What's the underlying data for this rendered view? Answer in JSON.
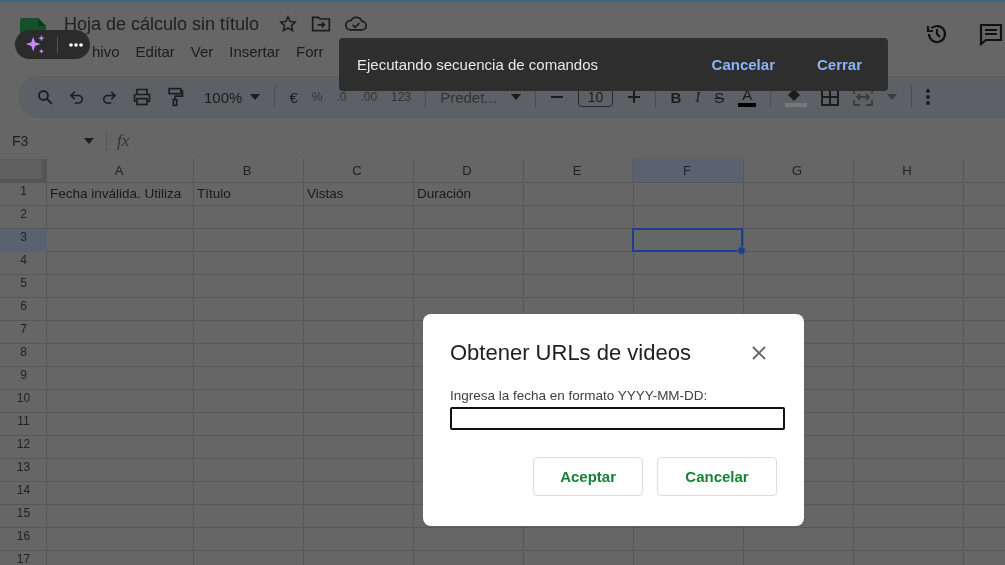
{
  "document": {
    "title": "Hoja de cálculo sin título"
  },
  "menus": [
    "hivo",
    "Editar",
    "Ver",
    "Insertar",
    "Forr"
  ],
  "toolbar": {
    "zoom": "100%",
    "currency": "€",
    "percent": "%",
    "decrease_decimals": ".0",
    "increase_decimals": ".00",
    "number_format": "123",
    "font": "Predet...",
    "font_size": "10",
    "bold": "B",
    "italic": "I",
    "strikethrough": "S",
    "text_color": "A"
  },
  "name_box": "F3",
  "formula_label": "fx",
  "columns": [
    {
      "label": "A",
      "selected": false
    },
    {
      "label": "B",
      "selected": false
    },
    {
      "label": "C",
      "selected": false
    },
    {
      "label": "D",
      "selected": false
    },
    {
      "label": "E",
      "selected": false
    },
    {
      "label": "F",
      "selected": true
    },
    {
      "label": "G",
      "selected": false
    },
    {
      "label": "H",
      "selected": false
    }
  ],
  "rows": [
    {
      "label": "1",
      "selected": false,
      "cells": [
        "Fecha inválida. Utiliza",
        "Título",
        "Vistas",
        "Duración"
      ]
    },
    {
      "label": "2",
      "selected": false
    },
    {
      "label": "3",
      "selected": true
    },
    {
      "label": "4",
      "selected": false
    },
    {
      "label": "5",
      "selected": false
    },
    {
      "label": "6",
      "selected": false
    },
    {
      "label": "7",
      "selected": false
    },
    {
      "label": "8",
      "selected": false
    },
    {
      "label": "9",
      "selected": false
    },
    {
      "label": "10",
      "selected": false
    },
    {
      "label": "11",
      "selected": false
    },
    {
      "label": "12",
      "selected": false
    },
    {
      "label": "13",
      "selected": false
    },
    {
      "label": "14",
      "selected": false
    },
    {
      "label": "15",
      "selected": false
    },
    {
      "label": "16",
      "selected": false
    },
    {
      "label": "17",
      "selected": false
    }
  ],
  "snackbar": {
    "message": "Ejecutando secuencia de comandos",
    "actions": [
      "Cancelar",
      "Cerrar"
    ]
  },
  "dialog": {
    "title": "Obtener URLs de videos",
    "prompt": "Ingresa la fecha en formato YYYY-MM-DD:",
    "buttons": [
      "Aceptar",
      "Cancelar"
    ]
  }
}
